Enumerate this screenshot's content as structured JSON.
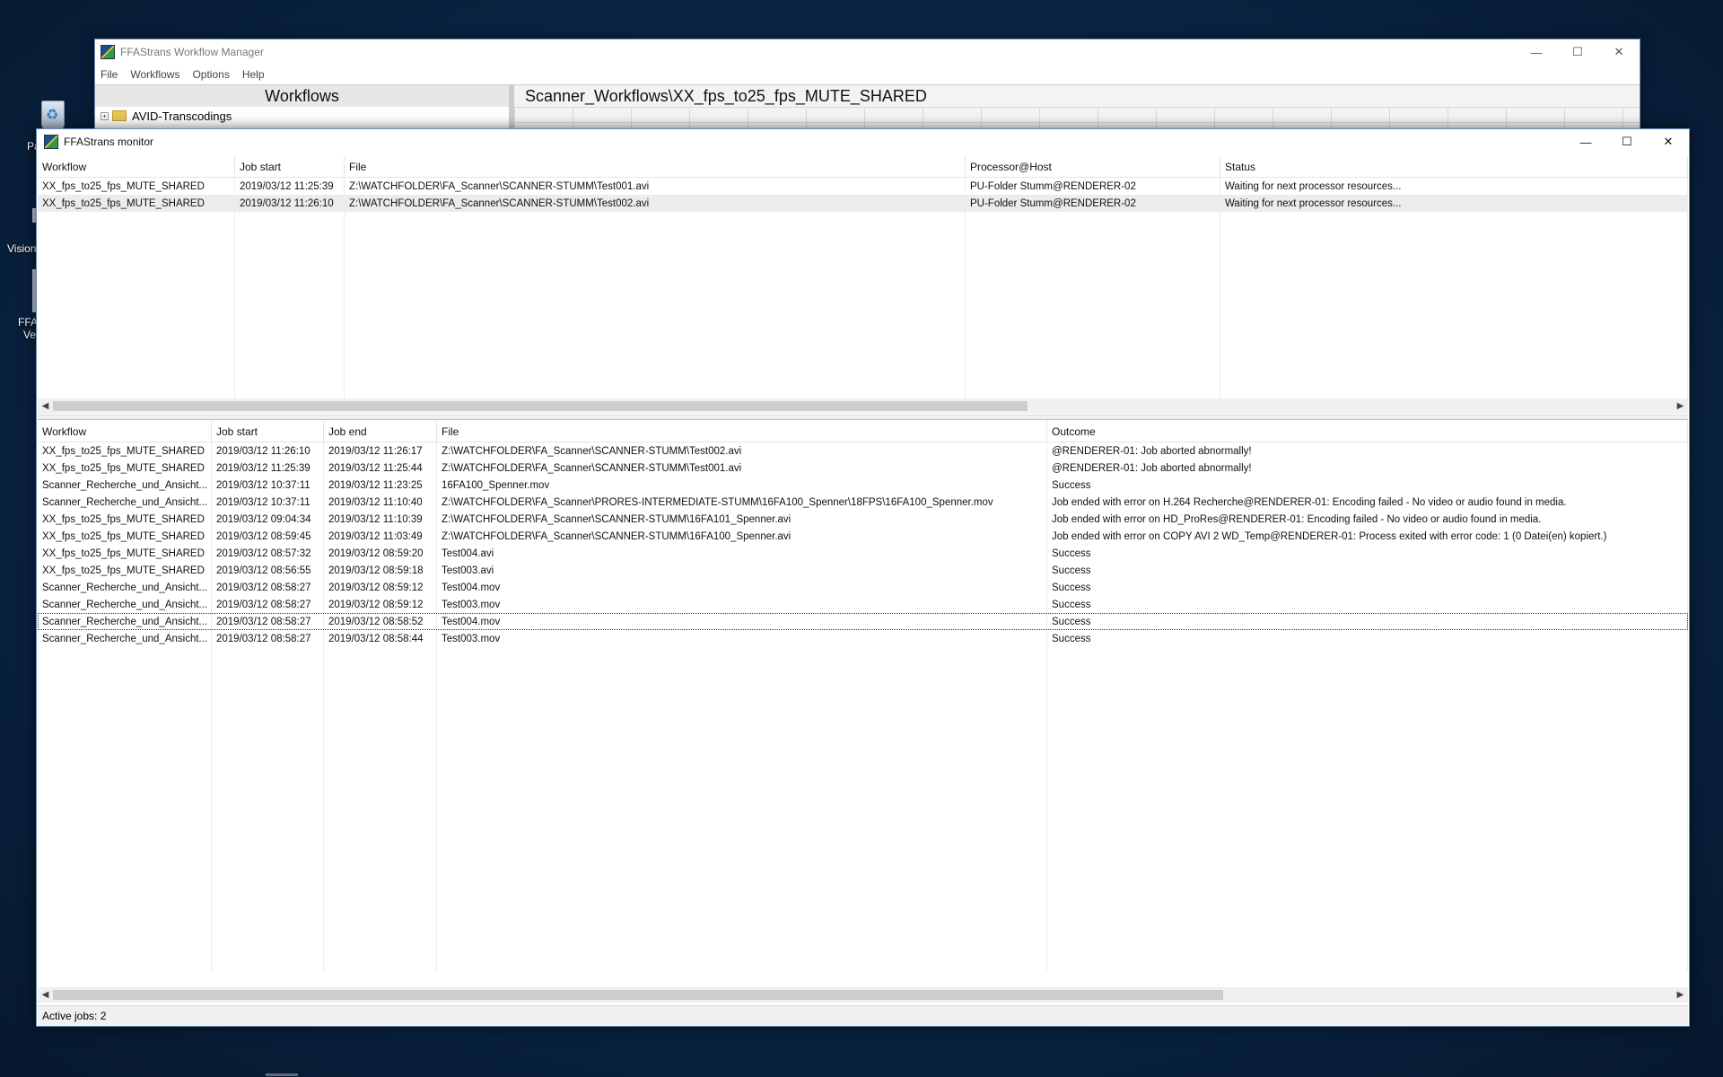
{
  "desktop": {
    "icon_labels": [
      "Pa",
      "Vision",
      "FFA",
      "Ver"
    ]
  },
  "manager": {
    "title": "FFAStrans Workflow Manager",
    "menu": [
      "File",
      "Workflows",
      "Options",
      "Help"
    ],
    "left_header": "Workflows",
    "tree": [
      {
        "label": "AVID-Transcodings"
      }
    ],
    "right_header": "Scanner_Workflows\\XX_fps_to25_fps_MUTE_SHARED"
  },
  "monitor": {
    "title": "FFAStrans monitor",
    "active_columns": [
      "Workflow",
      "Job start",
      "File",
      "Processor@Host",
      "Status"
    ],
    "active_rows": [
      [
        "XX_fps_to25_fps_MUTE_SHARED",
        "2019/03/12 11:25:39",
        "Z:\\WATCHFOLDER\\FA_Scanner\\SCANNER-STUMM\\Test001.avi",
        "PU-Folder Stumm@RENDERER-02",
        "Waiting for next processor resources..."
      ],
      [
        "XX_fps_to25_fps_MUTE_SHARED",
        "2019/03/12 11:26:10",
        "Z:\\WATCHFOLDER\\FA_Scanner\\SCANNER-STUMM\\Test002.avi",
        "PU-Folder Stumm@RENDERER-02",
        "Waiting for next processor resources..."
      ]
    ],
    "history_columns": [
      "Workflow",
      "Job start",
      "Job end",
      "File",
      "Outcome"
    ],
    "history_rows": [
      [
        "XX_fps_to25_fps_MUTE_SHARED",
        "2019/03/12 11:26:10",
        "2019/03/12 11:26:17",
        "Z:\\WATCHFOLDER\\FA_Scanner\\SCANNER-STUMM\\Test002.avi",
        "@RENDERER-01: Job aborted abnormally!"
      ],
      [
        "XX_fps_to25_fps_MUTE_SHARED",
        "2019/03/12 11:25:39",
        "2019/03/12 11:25:44",
        "Z:\\WATCHFOLDER\\FA_Scanner\\SCANNER-STUMM\\Test001.avi",
        "@RENDERER-01: Job aborted abnormally!"
      ],
      [
        "Scanner_Recherche_und_Ansicht...",
        "2019/03/12 10:37:11",
        "2019/03/12 11:23:25",
        "16FA100_Spenner.mov",
        "Success"
      ],
      [
        "Scanner_Recherche_und_Ansicht...",
        "2019/03/12 10:37:11",
        "2019/03/12 11:10:40",
        "Z:\\WATCHFOLDER\\FA_Scanner\\PRORES-INTERMEDIATE-STUMM\\16FA100_Spenner\\18FPS\\16FA100_Spenner.mov",
        "Job ended with error on H.264 Recherche@RENDERER-01: Encoding failed - No video or audio found in media."
      ],
      [
        "XX_fps_to25_fps_MUTE_SHARED",
        "2019/03/12 09:04:34",
        "2019/03/12 11:10:39",
        "Z:\\WATCHFOLDER\\FA_Scanner\\SCANNER-STUMM\\16FA101_Spenner.avi",
        "Job ended with error on HD_ProRes@RENDERER-01: Encoding failed - No video or audio found in media."
      ],
      [
        "XX_fps_to25_fps_MUTE_SHARED",
        "2019/03/12 08:59:45",
        "2019/03/12 11:03:49",
        "Z:\\WATCHFOLDER\\FA_Scanner\\SCANNER-STUMM\\16FA100_Spenner.avi",
        "Job ended with error on COPY AVI 2 WD_Temp@RENDERER-01: Process exited with error code: 1 (0 Datei(en) kopiert.)"
      ],
      [
        "XX_fps_to25_fps_MUTE_SHARED",
        "2019/03/12 08:57:32",
        "2019/03/12 08:59:20",
        "Test004.avi",
        "Success"
      ],
      [
        "XX_fps_to25_fps_MUTE_SHARED",
        "2019/03/12 08:56:55",
        "2019/03/12 08:59:18",
        "Test003.avi",
        "Success"
      ],
      [
        "Scanner_Recherche_und_Ansicht...",
        "2019/03/12 08:58:27",
        "2019/03/12 08:59:12",
        "Test004.mov",
        "Success"
      ],
      [
        "Scanner_Recherche_und_Ansicht...",
        "2019/03/12 08:58:27",
        "2019/03/12 08:59:12",
        "Test003.mov",
        "Success"
      ],
      [
        "Scanner_Recherche_und_Ansicht...",
        "2019/03/12 08:58:27",
        "2019/03/12 08:58:52",
        "Test004.mov",
        "Success"
      ],
      [
        "Scanner_Recherche_und_Ansicht...",
        "2019/03/12 08:58:27",
        "2019/03/12 08:58:44",
        "Test003.mov",
        "Success"
      ]
    ],
    "status_text": "Active jobs: 2"
  }
}
